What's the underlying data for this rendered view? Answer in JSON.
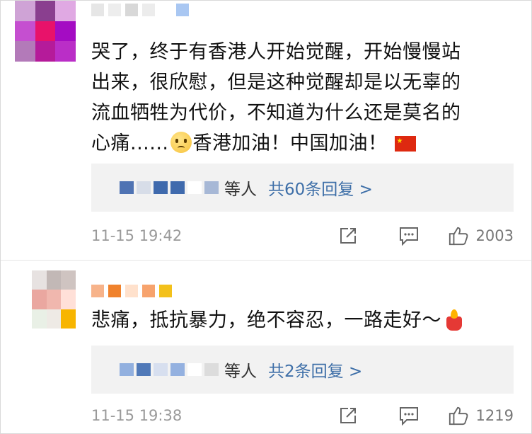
{
  "comments": [
    {
      "text_lines": [
        "哭了，终于有香港人开始觉醒，开始慢慢站",
        "出来，很欣慰，但是这种觉醒却是以无辜的",
        "流血牺牲为代价，不知道为什么还是莫名的"
      ],
      "last_line_start": "心痛......",
      "last_line_mid": "香港加油！中国加油！",
      "reply_suffix": "等人",
      "reply_link": "共60条回复 >",
      "time": "11-15 19:42",
      "likes": "2003",
      "avatar_colors": [
        "#cfa3d6",
        "#8a3f8f",
        "#e0a9e3",
        "#c54fd0",
        "#e8126a",
        "#a40cc3",
        "#b37ab9",
        "#b51b9a",
        "#ba2ec7"
      ],
      "name_colors": [
        "#e6e6e6",
        "#ededed",
        "#d8d8d8",
        "#ececec",
        "#ffffff",
        "#a9c7f2"
      ],
      "reply_name_colors": [
        "#4f73b3",
        "#d7dde8",
        "#3f6aad",
        "#3f6aad",
        "#ffffff",
        "#a7b8d6"
      ]
    },
    {
      "text": "悲痛，抵抗暴力，绝不容忍，一路走好～",
      "reply_suffix": "等人",
      "reply_link": "共2条回复 >",
      "time": "11-15 19:38",
      "likes": "1219",
      "avatar_colors": [
        "#e7e2e1",
        "#c2b8b6",
        "#cfc4c1",
        "#eaa7a0",
        "#f0b7ae",
        "#ffe0d8",
        "#e9f0e6",
        "#eeeae5",
        "#f7b500"
      ],
      "name_colors": [
        "#f7b38a",
        "#f0822c",
        "#ffe1cc",
        "#f7a36d",
        "#f3c11b"
      ],
      "reply_name_colors": [
        "#92b0df",
        "#5079b8",
        "#d7dfef",
        "#94b1e0",
        "#ffffff",
        "#dcdcdc"
      ]
    }
  ],
  "icons": {
    "share": "share-icon",
    "comment": "comment-icon",
    "like": "thumbs-up-icon",
    "face": "crying-face-icon",
    "flag": "china-flag-icon",
    "candle": "candle-icon"
  }
}
